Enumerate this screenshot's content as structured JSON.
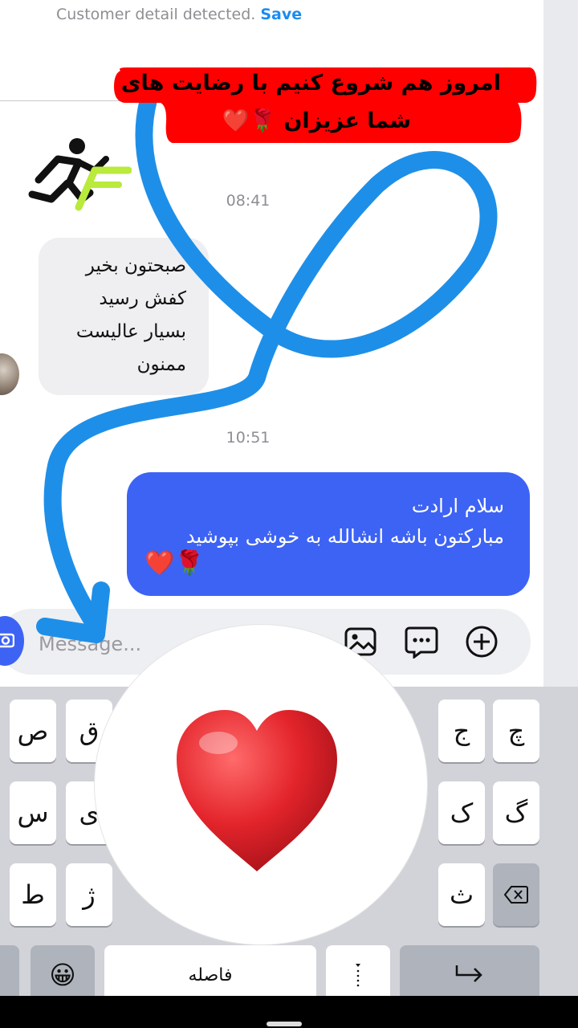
{
  "notice": {
    "text": "Customer detail detected.",
    "action": "Save"
  },
  "banner": {
    "line1": "امروز هم شروع کنیم با رضایت های",
    "line2": "شما عزیزان",
    "line2_emoji": "🌹❤️"
  },
  "timestamps": {
    "first": "08:41",
    "second": "10:51"
  },
  "incoming_message": {
    "lines": [
      "صبحتون بخیر",
      "کفش رسید",
      "بسیار عالیست",
      "ممنون"
    ]
  },
  "outgoing_message": {
    "lines": [
      "سلام ارادت",
      "مبارکتون باشه انشالله به خوشی بپوشید"
    ],
    "emoji": "❤️🌹"
  },
  "composer": {
    "placeholder": "Message..."
  },
  "keyboard": {
    "row1_left": [
      "ص",
      "ق"
    ],
    "row1_right": [
      "ج",
      "چ"
    ],
    "row2_left": [
      "س",
      "ی"
    ],
    "row2_right": [
      "ک",
      "گ"
    ],
    "row3_left": [
      "ط",
      "ژ"
    ],
    "row3_right": [
      "ث"
    ],
    "space_label": "فاصله",
    "emoji_key": "😀"
  },
  "colors": {
    "accent": "#3d63f5",
    "link": "#1a8cf0",
    "banner_bg": "#ff0000",
    "annotation_stroke": "#1e8fe8",
    "heart": "#e3242b"
  }
}
